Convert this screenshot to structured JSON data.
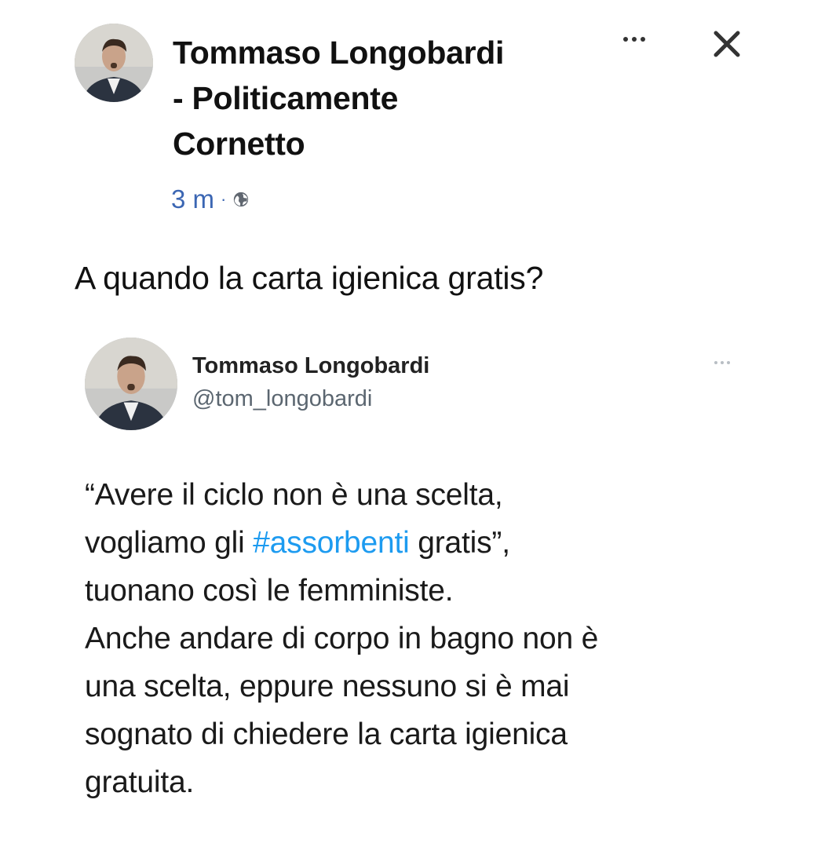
{
  "post": {
    "author_lines": [
      "Tommaso Longobardi",
      "- Politicamente",
      "Cornetto"
    ],
    "time": "3 m",
    "separator": "·",
    "privacy_icon": "globe-icon",
    "more_icon": "more-icon",
    "close_icon": "close-icon",
    "text": "A quando la carta igienica gratis?"
  },
  "tweet": {
    "name": "Tommaso Longobardi",
    "handle": "@tom_longobardi",
    "more_icon": "more-icon",
    "body": {
      "l1": "“Avere il ciclo non è una scelta,",
      "l2_pre": "vogliamo gli ",
      "l2_hashtag": "#assorbenti",
      "l2_post": " gratis”,",
      "l3": "tuonano così le femministe.",
      "l4": "Anche andare di corpo in bagno non è",
      "l5": "una scelta, eppure nessuno si è mai",
      "l6": "sognato di chiedere la carta igienica",
      "l7": "gratuita."
    }
  },
  "colors": {
    "link": "#1d9bf0",
    "meta": "#3b66b3",
    "text": "#111111"
  }
}
